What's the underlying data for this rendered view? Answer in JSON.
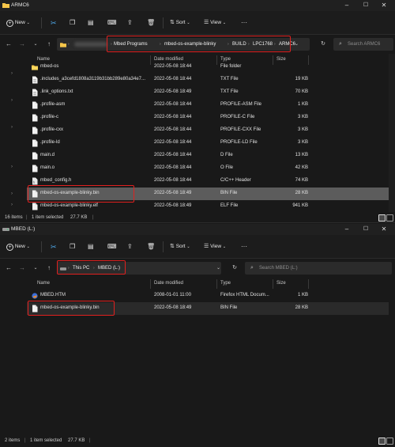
{
  "window1": {
    "title": "ARMC6",
    "toolbar": {
      "new": "New",
      "sort": "Sort",
      "view": "View"
    },
    "breadcrumbs": [
      "Mbed Programs",
      "mbed-os-example-blinky",
      "BUILD",
      "LPC1768",
      "ARMC6"
    ],
    "search_placeholder": "Search ARMC6",
    "columns": {
      "name": "Name",
      "date": "Date modified",
      "type": "Type",
      "size": "Size"
    },
    "files": [
      {
        "name": "mbed-os",
        "date": "2022-05-08 18:44",
        "type": "File folder",
        "size": "",
        "icon": "folder-icon"
      },
      {
        "name": ".includes_a3cefd1808a3119b31bb289e80a34e7...",
        "date": "2022-05-08 18:44",
        "type": "TXT File",
        "size": "19 KB",
        "icon": "text-file-icon"
      },
      {
        "name": ".link_options.txt",
        "date": "2022-05-08 18:49",
        "type": "TXT File",
        "size": "70 KB",
        "icon": "text-file-icon"
      },
      {
        "name": ".profile-asm",
        "date": "2022-05-08 18:44",
        "type": "PROFILE-ASM File",
        "size": "1 KB",
        "icon": "file-icon"
      },
      {
        "name": ".profile-c",
        "date": "2022-05-08 18:44",
        "type": "PROFILE-C File",
        "size": "3 KB",
        "icon": "file-icon"
      },
      {
        "name": ".profile-cxx",
        "date": "2022-05-08 18:44",
        "type": "PROFILE-CXX File",
        "size": "3 KB",
        "icon": "file-icon"
      },
      {
        "name": ".profile-ld",
        "date": "2022-05-08 18:44",
        "type": "PROFILE-LD File",
        "size": "3 KB",
        "icon": "file-icon"
      },
      {
        "name": "main.d",
        "date": "2022-05-08 18:44",
        "type": "D File",
        "size": "13 KB",
        "icon": "file-icon"
      },
      {
        "name": "main.o",
        "date": "2022-05-08 18:44",
        "type": "O File",
        "size": "42 KB",
        "icon": "file-icon"
      },
      {
        "name": "mbed_config.h",
        "date": "2022-05-08 18:44",
        "type": "C/C++ Header",
        "size": "74 KB",
        "icon": "header-file-icon"
      },
      {
        "name": "mbed-os-example-blinky.bin",
        "date": "2022-05-08 18:49",
        "type": "BIN File",
        "size": "28 KB",
        "icon": "file-icon"
      },
      {
        "name": "mbed-os-example-blinky.elf",
        "date": "2022-05-08 18:49",
        "type": "ELF File",
        "size": "941 KB",
        "icon": "file-icon"
      }
    ],
    "status": {
      "count": "16 items",
      "selected": "1 item selected",
      "size": "27.7 KB"
    }
  },
  "window2": {
    "title": "MBED (L:)",
    "toolbar": {
      "new": "New",
      "sort": "Sort",
      "view": "View"
    },
    "breadcrumbs": [
      "This PC",
      "MBED (L:)"
    ],
    "search_placeholder": "Search MBED (L:)",
    "columns": {
      "name": "Name",
      "date": "Date modified",
      "type": "Type",
      "size": "Size"
    },
    "files": [
      {
        "name": "MBED.HTM",
        "date": "2008-01-01 11:00",
        "type": "Firefox HTML Docum...",
        "size": "1 KB",
        "icon": "firefox-html-icon"
      },
      {
        "name": "mbed-os-example-blinky.bin",
        "date": "2022-05-08 18:49",
        "type": "BIN File",
        "size": "28 KB",
        "icon": "file-icon"
      }
    ],
    "status": {
      "count": "2 items",
      "selected": "1 item selected",
      "size": "27.7 KB"
    }
  }
}
